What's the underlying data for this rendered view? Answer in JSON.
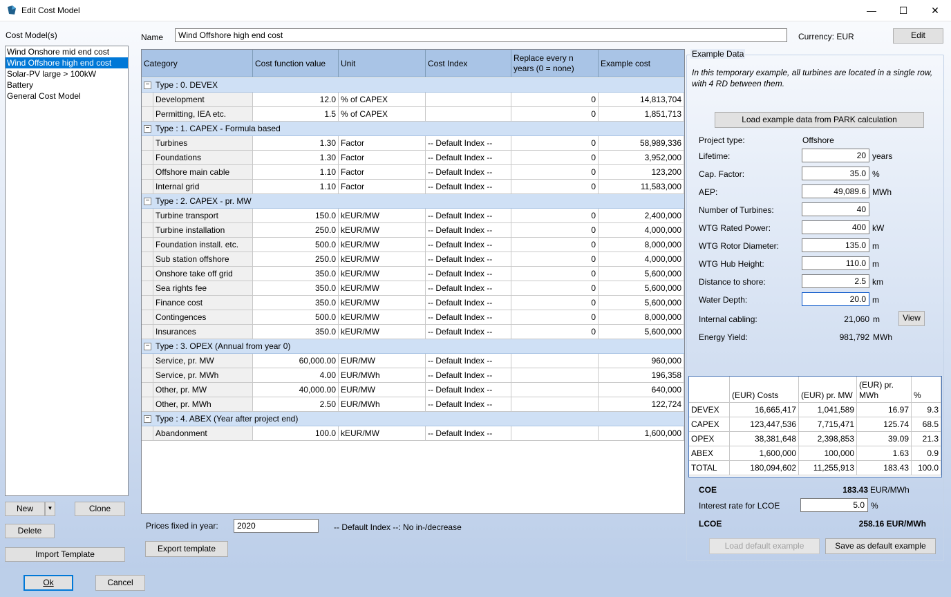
{
  "window": {
    "title": "Edit Cost Model",
    "minimize": "—",
    "maximize": "☐",
    "close": "✕"
  },
  "left": {
    "cost_models_label": "Cost Model(s)",
    "items": [
      "Wind Onshore mid end cost",
      "Wind Offshore high end cost",
      "Solar-PV large > 100kW",
      "Battery",
      "General Cost Model"
    ],
    "new_label": "New",
    "dropdown_arrow": "▼",
    "clone_label": "Clone",
    "delete_label": "Delete",
    "import_template_label": "Import Template"
  },
  "header": {
    "name_label": "Name",
    "name_value": "Wind Offshore high end cost",
    "currency_label": "Currency: EUR",
    "edit_label": "Edit"
  },
  "grid": {
    "columns": [
      "Category",
      "Cost function value",
      "Unit",
      "Cost Index",
      "Replace every n years (0 = none)",
      "Example cost"
    ],
    "groups": [
      {
        "label": "Type : 0. DEVEX",
        "toggle": "−",
        "rows": [
          [
            "Development",
            "12.0",
            "% of CAPEX",
            "",
            "0",
            "14,813,704"
          ],
          [
            "Permitting, IEA etc.",
            "1.5",
            "% of CAPEX",
            "",
            "0",
            "1,851,713"
          ]
        ]
      },
      {
        "label": "Type : 1. CAPEX - Formula based",
        "toggle": "−",
        "rows": [
          [
            "Turbines",
            "1.30",
            "Factor",
            "-- Default Index --",
            "0",
            "58,989,336"
          ],
          [
            "Foundations",
            "1.30",
            "Factor",
            "-- Default Index --",
            "0",
            "3,952,000"
          ],
          [
            "Offshore main cable",
            "1.10",
            "Factor",
            "-- Default Index --",
            "0",
            "123,200"
          ],
          [
            "Internal grid",
            "1.10",
            "Factor",
            "-- Default Index --",
            "0",
            "11,583,000"
          ]
        ]
      },
      {
        "label": "Type : 2. CAPEX - pr. MW",
        "toggle": "−",
        "rows": [
          [
            "Turbine transport",
            "150.0",
            "kEUR/MW",
            "-- Default Index --",
            "0",
            "2,400,000"
          ],
          [
            "Turbine installation",
            "250.0",
            "kEUR/MW",
            "-- Default Index --",
            "0",
            "4,000,000"
          ],
          [
            "Foundation install. etc.",
            "500.0",
            "kEUR/MW",
            "-- Default Index --",
            "0",
            "8,000,000"
          ],
          [
            "Sub station offshore",
            "250.0",
            "kEUR/MW",
            "-- Default Index --",
            "0",
            "4,000,000"
          ],
          [
            "Onshore take off grid",
            "350.0",
            "kEUR/MW",
            "-- Default Index --",
            "0",
            "5,600,000"
          ],
          [
            "Sea rights fee",
            "350.0",
            "kEUR/MW",
            "-- Default Index --",
            "0",
            "5,600,000"
          ],
          [
            "Finance cost",
            "350.0",
            "kEUR/MW",
            "-- Default Index --",
            "0",
            "5,600,000"
          ],
          [
            "Contingences",
            "500.0",
            "kEUR/MW",
            "-- Default Index --",
            "0",
            "8,000,000"
          ],
          [
            "Insurances",
            "350.0",
            "kEUR/MW",
            "-- Default Index --",
            "0",
            "5,600,000"
          ]
        ]
      },
      {
        "label": "Type : 3. OPEX (Annual from year 0)",
        "toggle": "−",
        "rows": [
          [
            "Service, pr. MW",
            "60,000.00",
            "EUR/MW",
            "-- Default Index --",
            "",
            "960,000"
          ],
          [
            "Service, pr. MWh",
            "4.00",
            "EUR/MWh",
            "-- Default Index --",
            "",
            "196,358"
          ],
          [
            "Other, pr. MW",
            "40,000.00",
            "EUR/MW",
            "-- Default Index --",
            "",
            "640,000"
          ],
          [
            "Other, pr. MWh",
            "2.50",
            "EUR/MWh",
            "-- Default Index --",
            "",
            "122,724"
          ]
        ]
      },
      {
        "label": "Type : 4. ABEX (Year after project end)",
        "toggle": "−",
        "rows": [
          [
            "Abandonment",
            "100.0",
            "kEUR/MW",
            "-- Default Index --",
            "",
            "1,600,000"
          ]
        ]
      }
    ]
  },
  "below_grid": {
    "prices_fixed_label": "Prices fixed in year:",
    "prices_fixed_value": "2020",
    "default_index_note": "-- Default Index --: No in-/decrease",
    "export_template_label": "Export template"
  },
  "example": {
    "title": "Example Data",
    "note": "In this temporary example, all turbines are located in a single row, with 4 RD between them.",
    "load_park_label": "Load example data from PARK calculation",
    "project_type_label": "Project type:",
    "project_type_value": "Offshore",
    "fields": [
      {
        "label": "Lifetime:",
        "value": "20",
        "unit": "years"
      },
      {
        "label": "Cap. Factor:",
        "value": "35.0",
        "unit": "%"
      },
      {
        "label": "AEP:",
        "value": "49,089.6",
        "unit": "MWh"
      },
      {
        "label": "Number of Turbines:",
        "value": "40",
        "unit": ""
      },
      {
        "label": "WTG Rated Power:",
        "value": "400",
        "unit": "kW"
      },
      {
        "label": "WTG Rotor Diameter:",
        "value": "135.0",
        "unit": "m"
      },
      {
        "label": "WTG Hub Height:",
        "value": "110.0",
        "unit": "m"
      },
      {
        "label": "Distance to shore:",
        "value": "2.5",
        "unit": "km"
      },
      {
        "label": "Water Depth:",
        "value": "20.0",
        "unit": "m"
      }
    ],
    "internal_cabling_label": "Internal cabling:",
    "internal_cabling_value": "21,060",
    "internal_cabling_unit": "m",
    "view_label": "View",
    "energy_yield_label": "Energy Yield:",
    "energy_yield_value": "981,792",
    "energy_yield_unit": "MWh",
    "summary": {
      "columns": [
        "",
        "(EUR) Costs",
        "(EUR) pr. MW",
        "(EUR) pr. MWh",
        "%"
      ],
      "rows": [
        [
          "DEVEX",
          "16,665,417",
          "1,041,589",
          "16.97",
          "9.3"
        ],
        [
          "CAPEX",
          "123,447,536",
          "7,715,471",
          "125.74",
          "68.5"
        ],
        [
          "OPEX",
          "38,381,648",
          "2,398,853",
          "39.09",
          "21.3"
        ],
        [
          "ABEX",
          "1,600,000",
          "100,000",
          "1.63",
          "0.9"
        ],
        [
          "TOTAL",
          "180,094,602",
          "11,255,913",
          "183.43",
          "100.0"
        ]
      ]
    },
    "coe_label": "COE",
    "coe_value": "183.43",
    "coe_unit": "EUR/MWh",
    "interest_label": "Interest rate for LCOE",
    "interest_value": "5.0",
    "interest_unit": "%",
    "lcoe_label": "LCOE",
    "lcoe_value": "258.16 EUR/MWh",
    "load_default_label": "Load default example",
    "save_default_label": "Save as default example"
  },
  "footer": {
    "ok_label": "Ok",
    "cancel_label": "Cancel"
  }
}
